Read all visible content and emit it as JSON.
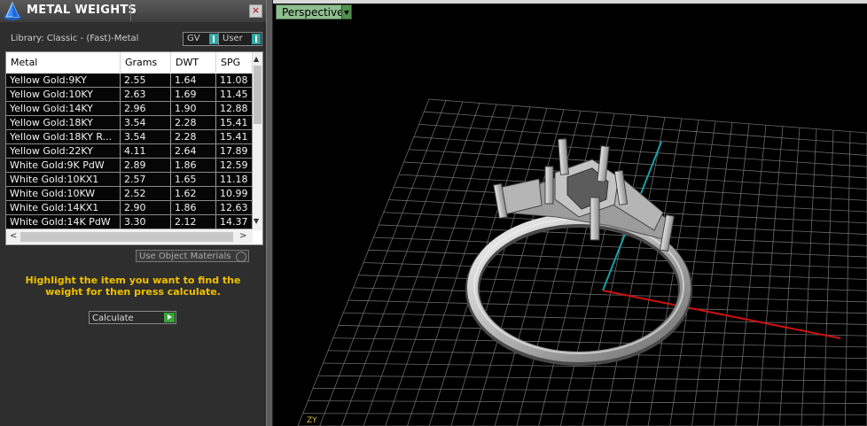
{
  "panel": {
    "title": "METAL WEIGHTS",
    "close_glyph": "×",
    "library_label": "Library: Classic - (Fast)-Metal",
    "gv_toggle": "GV",
    "user_toggle": "User"
  },
  "table": {
    "columns": [
      "Metal",
      "Grams",
      "DWT",
      "SPG"
    ],
    "rows": [
      [
        "Yellow Gold:9KY",
        "2.55",
        "1.64",
        "11.08"
      ],
      [
        "Yellow Gold:10KY",
        "2.63",
        "1.69",
        "11.45"
      ],
      [
        "Yellow Gold:14KY",
        "2.96",
        "1.90",
        "12.88"
      ],
      [
        "Yellow Gold:18KY",
        "3.54",
        "2.28",
        "15.41"
      ],
      [
        "Yellow Gold:18KY R...",
        "3.54",
        "2.28",
        "15.41"
      ],
      [
        "Yellow Gold:22KY",
        "4.11",
        "2.64",
        "17.89"
      ],
      [
        "White Gold:9K PdW",
        "2.89",
        "1.86",
        "12.59"
      ],
      [
        "White Gold:10KX1",
        "2.57",
        "1.65",
        "11.18"
      ],
      [
        "White Gold:10KW",
        "2.52",
        "1.62",
        "10.99"
      ],
      [
        "White Gold:14KX1",
        "2.90",
        "1.86",
        "12.63"
      ],
      [
        "White Gold:14K PdW",
        "3.30",
        "2.12",
        "14.37"
      ]
    ]
  },
  "use_object_materials_label": "Use Object Materials",
  "hint": "Highlight the item you want to find the weight for then press calculate.",
  "calculate_label": "Calculate",
  "viewport": {
    "view_label": "Perspective",
    "axis_indicator": "ZY"
  },
  "colors": {
    "accent_teal": "#2fa6a6",
    "hint_yellow": "#f0c000",
    "viewport_label_green": "#8fbf8f",
    "x_axis_red": "#d01010",
    "y_axis_teal": "#1aa0a8"
  }
}
